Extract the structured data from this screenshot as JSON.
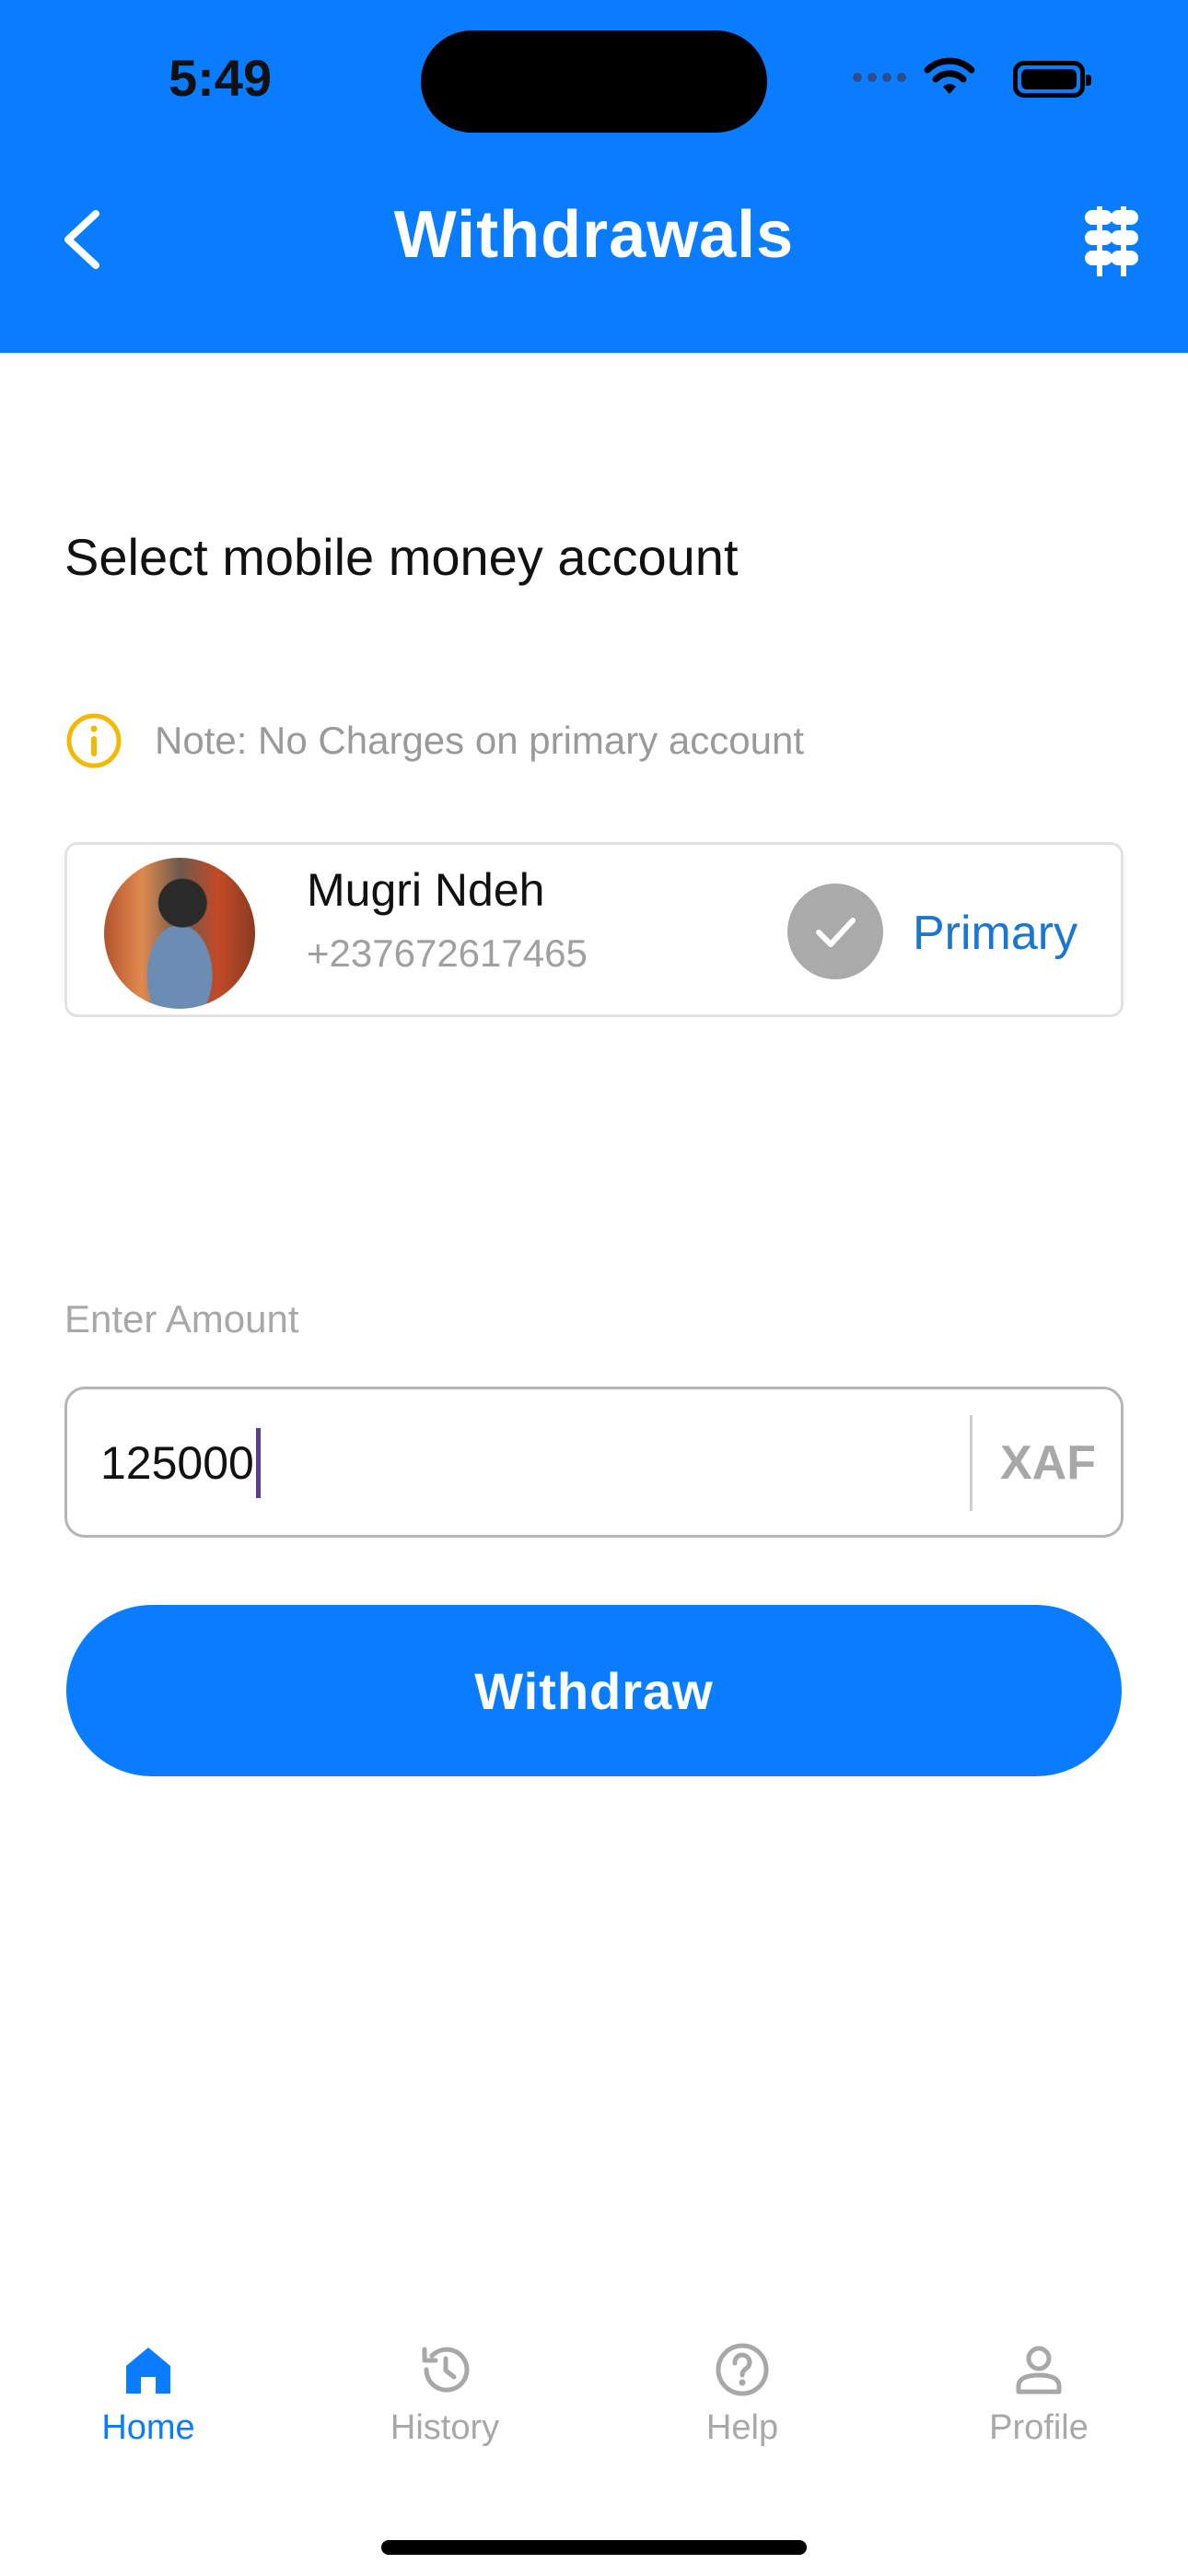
{
  "status_bar": {
    "time": "5:49"
  },
  "header": {
    "title": "Withdrawals",
    "back_icon": "chevron-left-icon",
    "menu_icon": "mobile-money-icon"
  },
  "content": {
    "section_title": "Select mobile money account",
    "note": "Note: No Charges on primary account",
    "account": {
      "name": "Mugri Ndeh",
      "phone": "+237672617465",
      "badge": "Primary"
    },
    "amount": {
      "label": "Enter Amount",
      "value": "125000",
      "currency": "XAF"
    },
    "withdraw_label": "Withdraw"
  },
  "tabbar": {
    "items": [
      {
        "label": "Home",
        "icon": "home-icon",
        "active": true
      },
      {
        "label": "History",
        "icon": "history-icon",
        "active": false
      },
      {
        "label": "Help",
        "icon": "help-icon",
        "active": false
      },
      {
        "label": "Profile",
        "icon": "profile-icon",
        "active": false
      }
    ]
  },
  "colors": {
    "primary": "#0A7CFF",
    "link": "#1976D2",
    "muted": "#A8A8A8",
    "note_icon": "#F5B800"
  }
}
